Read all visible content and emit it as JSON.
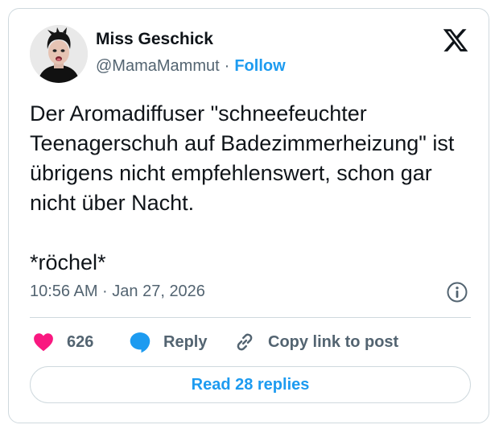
{
  "author": {
    "display_name": "Miss Geschick",
    "handle": "@MamaMammut",
    "separator": "·",
    "follow_label": "Follow"
  },
  "tweet": {
    "text": "Der Aromadiffuser \"schneefeuchter Teenagerschuh auf Badezimmerheizung\" ist übrigens nicht empfehlenswert, schon gar nicht über Nacht.\n\n*röchel*",
    "timestamp": "10:56 AM · Jan 27, 2026"
  },
  "actions": {
    "like_count": "626",
    "reply_label": "Reply",
    "copy_link_label": "Copy link to post"
  },
  "read_replies_label": "Read 28 replies",
  "icons": {
    "brand": "x-logo-icon",
    "info": "info-icon",
    "like": "heart-icon",
    "reply": "speech-bubble-icon",
    "copy": "link-icon"
  },
  "colors": {
    "accent": "#1d9bf0",
    "like": "#f91880",
    "text": "#0f1419",
    "muted": "#536471",
    "border": "#cfd9de"
  }
}
